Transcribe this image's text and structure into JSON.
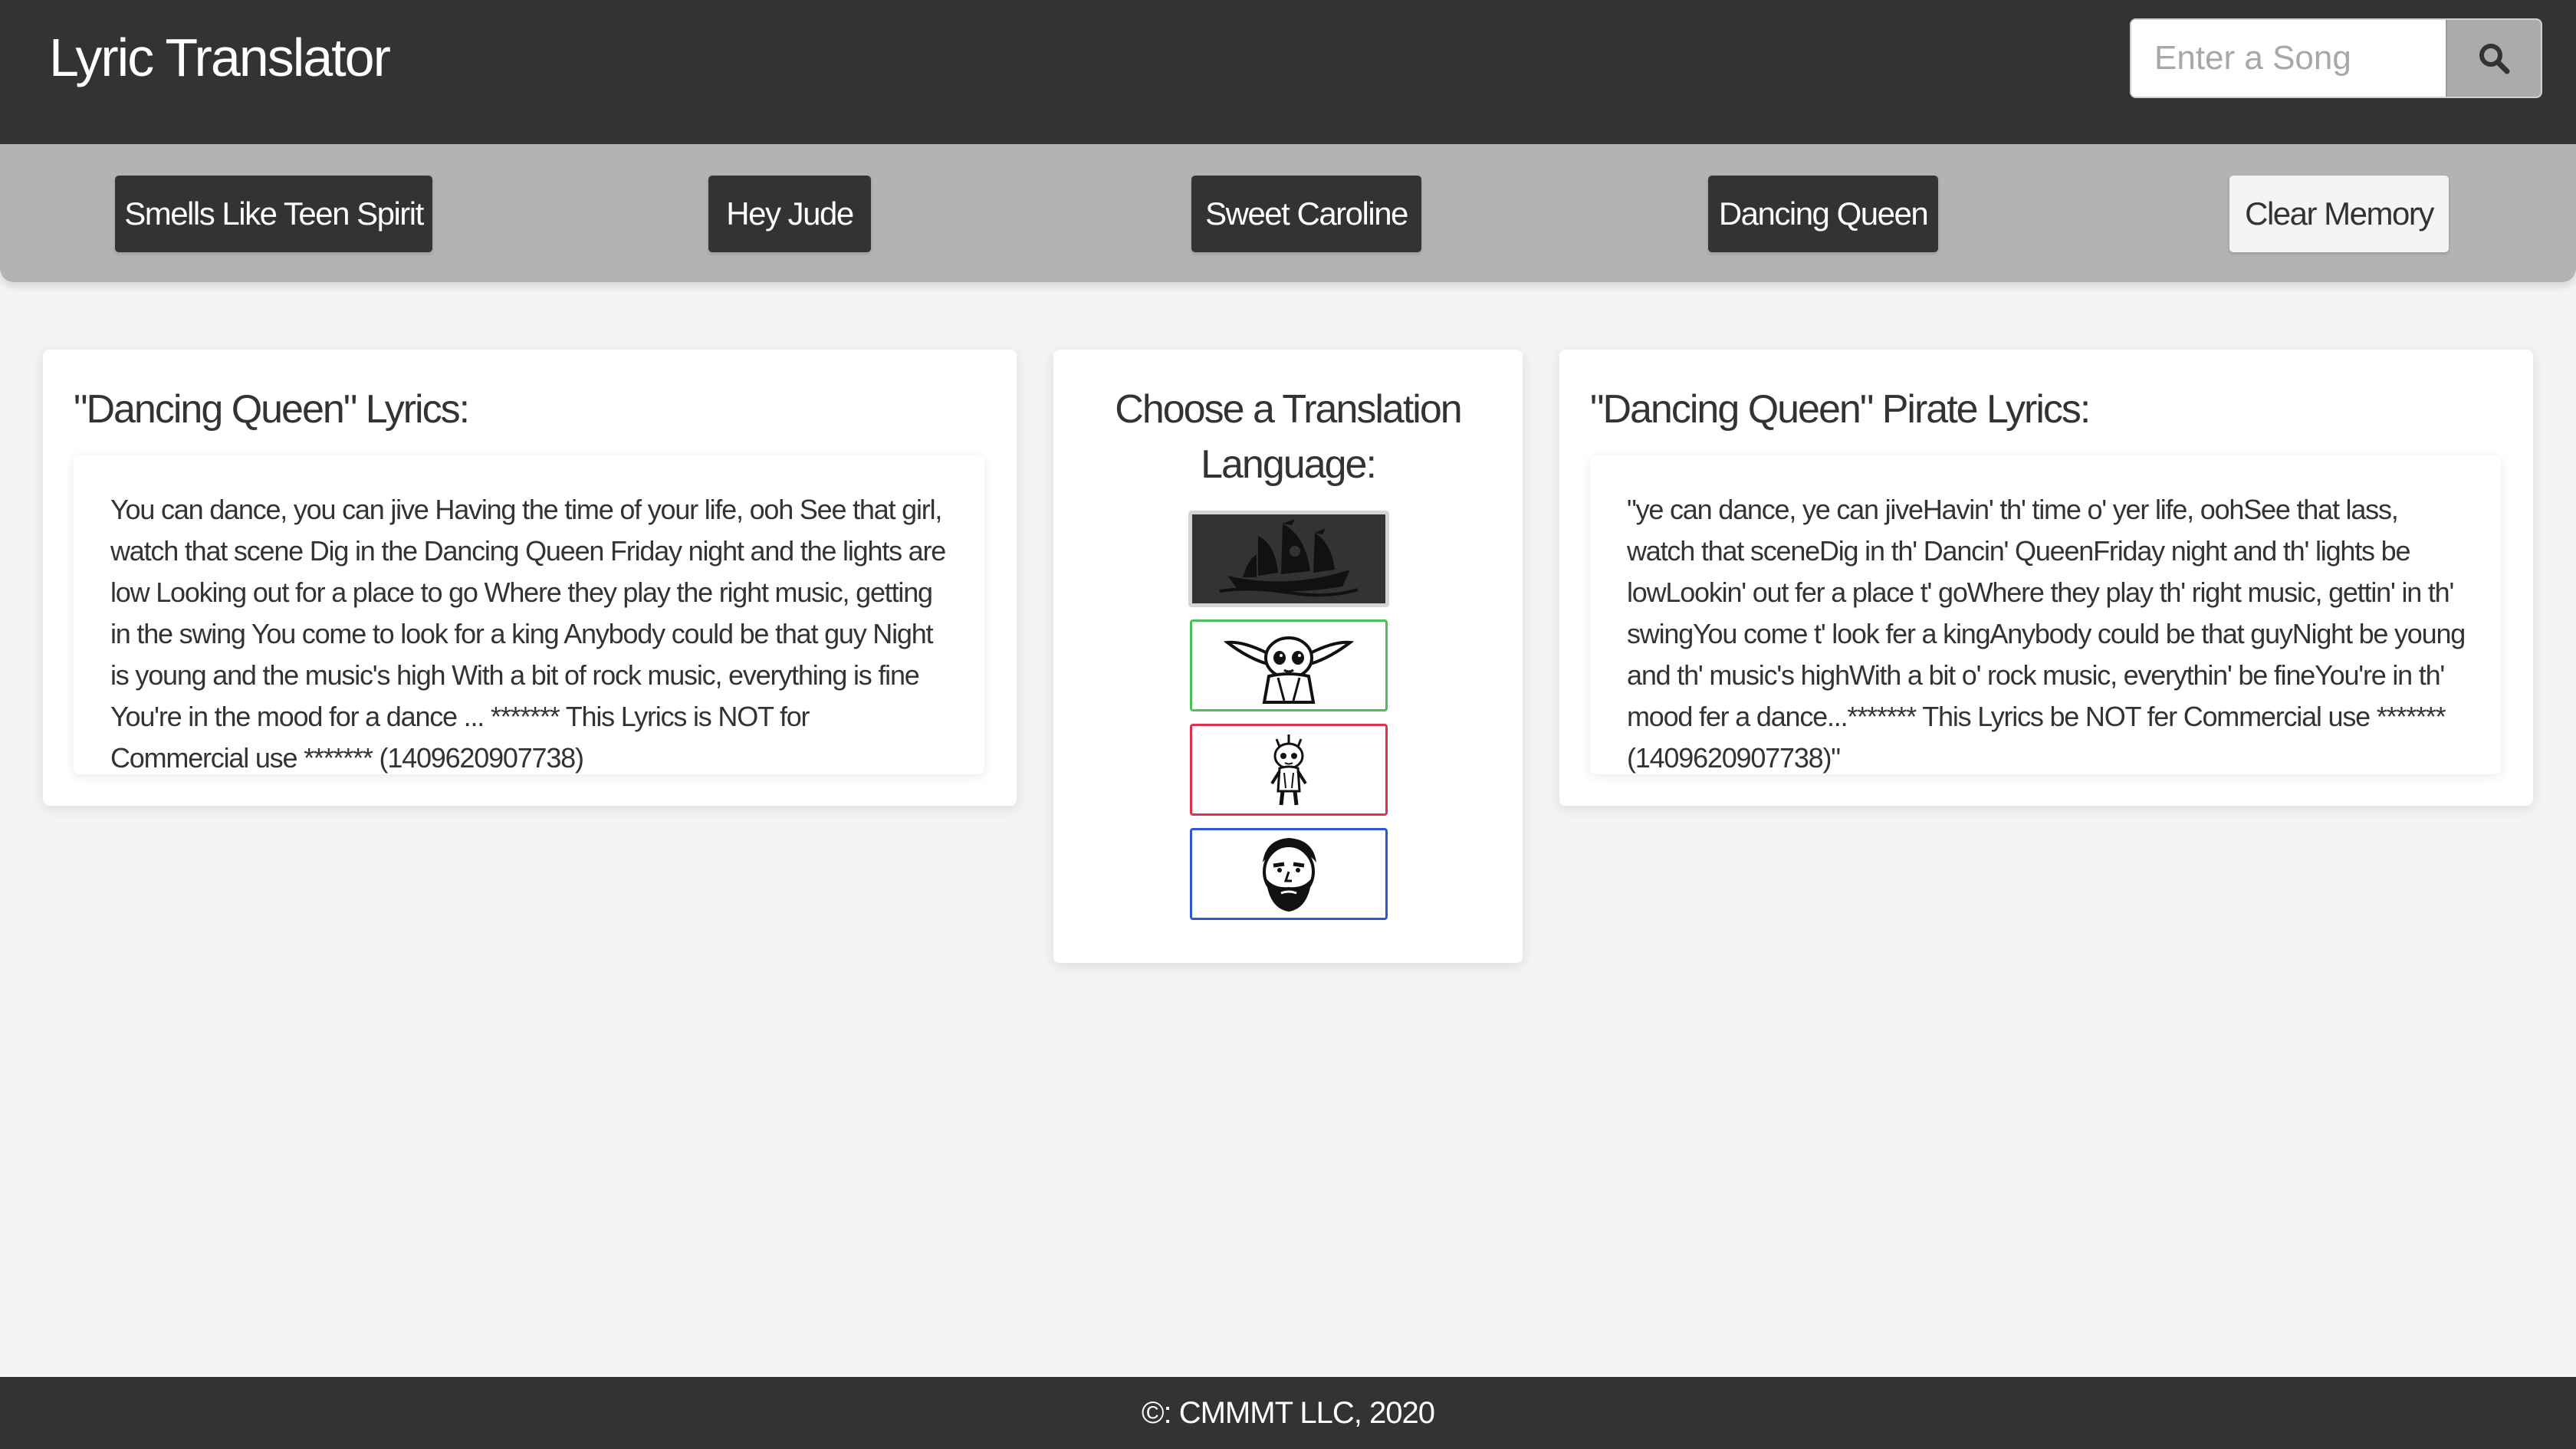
{
  "header": {
    "title": "Lyric Translator",
    "search_placeholder": "Enter a Song",
    "search_icon": "search-icon"
  },
  "song_bar": {
    "songs": [
      "Smells Like Teen Spirit",
      "Hey Jude",
      "Sweet Caroline",
      "Dancing Queen"
    ],
    "clear_label": "Clear Memory"
  },
  "original": {
    "title": "\"Dancing Queen\" Lyrics:",
    "lyrics": "You can dance, you can jive Having the time of your life, ooh See that girl, watch that scene Dig in the Dancing Queen Friday night and the lights are low Looking out for a place to go Where they play the right music, getting in the swing You come to look for a king Anybody could be that guy Night is young and the music's high With a bit of rock music, everything is fine You're in the mood for a dance ... ******* This Lyrics is NOT for Commercial use ******* (1409620907738)"
  },
  "languages": {
    "title": "Choose a Translation Language:",
    "options": [
      {
        "name": "pirate-ship-icon",
        "border": "#d5d5d5",
        "selected": true
      },
      {
        "name": "baby-yoda-icon",
        "border": "#4cc05a",
        "selected": false
      },
      {
        "name": "groot-icon",
        "border": "#e0324f",
        "selected": false
      },
      {
        "name": "hodor-icon",
        "border": "#2f55d8",
        "selected": false
      }
    ]
  },
  "translated": {
    "title": "\"Dancing Queen\" Pirate Lyrics:",
    "lyrics": "\"ye can dance, ye can jiveHavin' th' time o' yer life, oohSee that lass, watch that sceneDig in th' Dancin' QueenFriday night and th' lights be lowLookin' out fer a place t' goWhere they play th' right music, gettin' in th' swingYou come t' look fer a kingAnybody could be that guyNight be young and th' music's highWith a bit o' rock music, everythin' be fineYou're in th' mood fer a dance...******* This Lyrics be NOT fer Commercial use *******(1409620907738)\""
  },
  "footer": {
    "text": "©: CMMMT LLC, 2020"
  },
  "colors": {
    "header_bg": "#333333",
    "song_bar_bg": "#b3b3b3",
    "page_bg": "#f4f4f4"
  }
}
